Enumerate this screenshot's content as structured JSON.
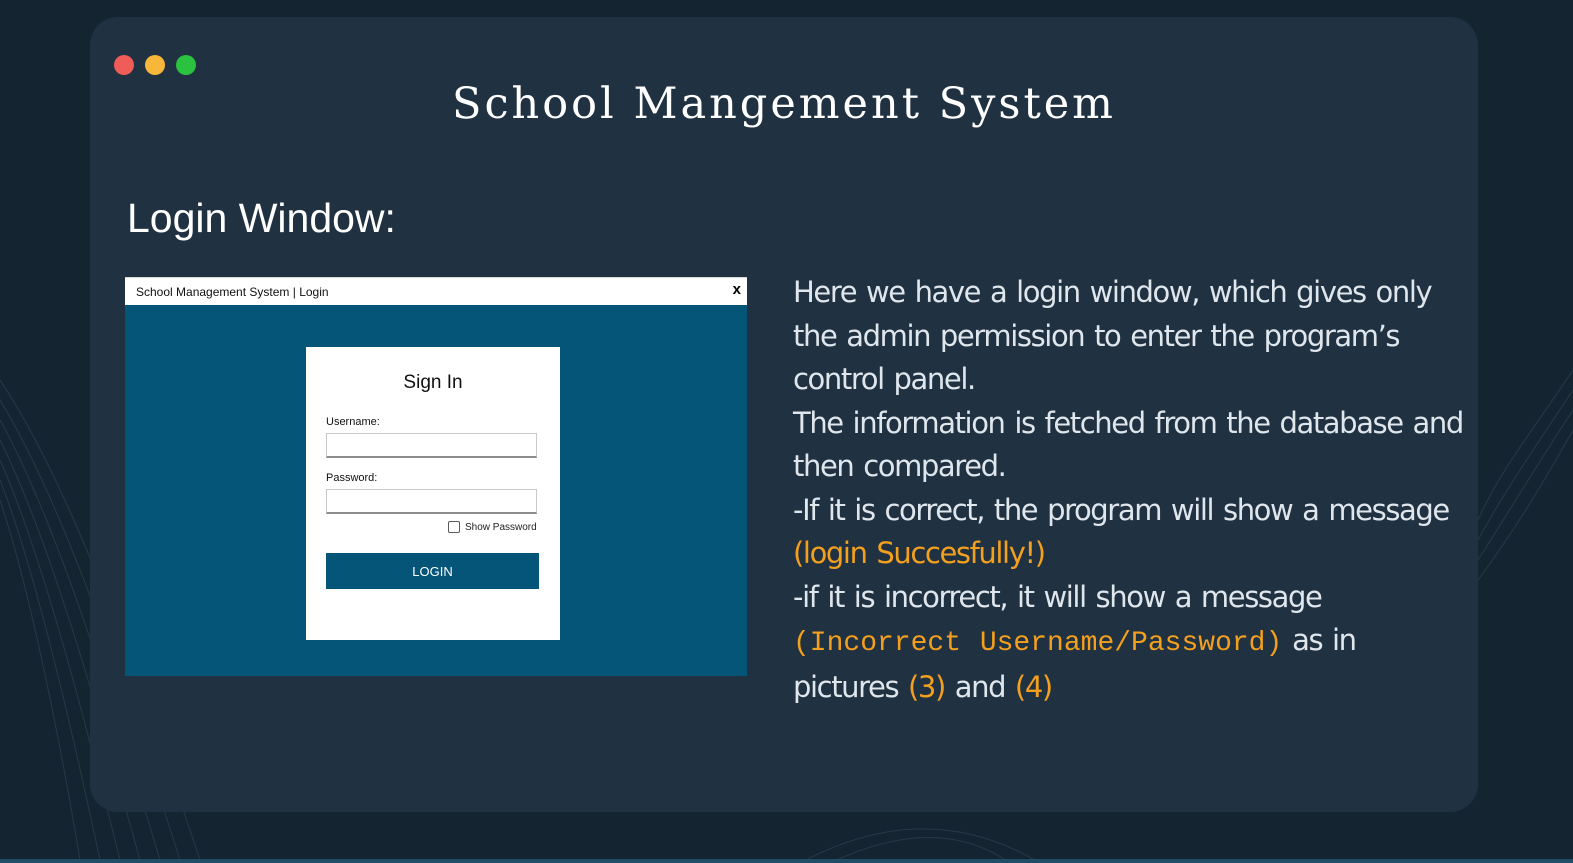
{
  "slide": {
    "title": "School Mangement System",
    "section_heading": "Login Window:"
  },
  "window_controls": [
    "close-dot",
    "minimize-dot",
    "maximize-dot"
  ],
  "colors": {
    "page_background": "#152431",
    "card_background": "#203141",
    "screenshot_blue": "#045577",
    "highlight_orange": "#f2a01d",
    "body_text": "#dfe6ec"
  },
  "login_window": {
    "title": "School Management System | Login",
    "close_label": "x",
    "heading": "Sign In",
    "username_label": "Username:",
    "username_value": "",
    "password_label": "Password:",
    "password_value": "",
    "show_password_label": "Show Password",
    "show_password_checked": false,
    "login_button": "LOGIN"
  },
  "description": {
    "line_1": "Here we have a login window, which gives only the admin permission to enter the program’s control panel.",
    "line_2": "The information is fetched from the database and then compared.",
    "line_3_pre": "-If it is correct, the program will show a message ",
    "success_message": "(login Succesfully!)",
    "line_4_pre": "-if it is incorrect, it will show a message ",
    "error_message": "(Incorrect Username/Password)",
    "line_4_mid": " as in pictures ",
    "picture_ref_1": "(3)",
    "line_4_and": " and ",
    "picture_ref_2": "(4)"
  }
}
